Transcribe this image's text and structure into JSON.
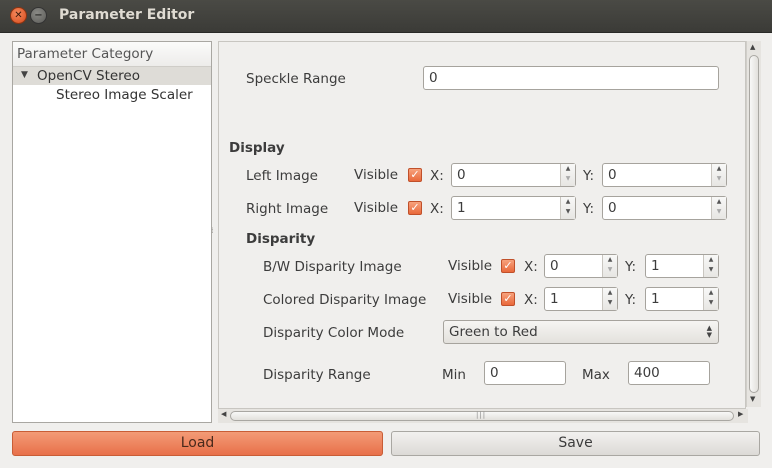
{
  "window": {
    "title": "Parameter Editor"
  },
  "sidebar": {
    "header": "Parameter Category",
    "items": [
      {
        "label": "OpenCV Stereo",
        "expanded": true,
        "selected": true
      },
      {
        "label": "Stereo Image Scaler"
      }
    ]
  },
  "form": {
    "speckle_range": {
      "label": "Speckle Range",
      "value": "0"
    },
    "display": {
      "title": "Display",
      "left_image": {
        "label": "Left Image",
        "visible_label": "Visible",
        "visible": true,
        "x_label": "X:",
        "x": "0",
        "y_label": "Y:",
        "y": "0"
      },
      "right_image": {
        "label": "Right Image",
        "visible_label": "Visible",
        "visible": true,
        "x_label": "X:",
        "x": "1",
        "y_label": "Y:",
        "y": "0"
      }
    },
    "disparity": {
      "title": "Disparity",
      "bw_image": {
        "label": "B/W Disparity Image",
        "visible_label": "Visible",
        "visible": true,
        "x_label": "X:",
        "x": "0",
        "y_label": "Y:",
        "y": "1"
      },
      "colored_image": {
        "label": "Colored Disparity Image",
        "visible_label": "Visible",
        "visible": true,
        "x_label": "X:",
        "x": "1",
        "y_label": "Y:",
        "y": "1"
      },
      "color_mode": {
        "label": "Disparity Color Mode",
        "value": "Green to Red"
      },
      "range": {
        "label": "Disparity Range",
        "min_label": "Min",
        "min": "0",
        "max_label": "Max",
        "max": "400"
      }
    }
  },
  "buttons": {
    "load": "Load",
    "save": "Save"
  },
  "colors": {
    "accent": "#e9693b",
    "titlebar": "#3c3b37"
  }
}
